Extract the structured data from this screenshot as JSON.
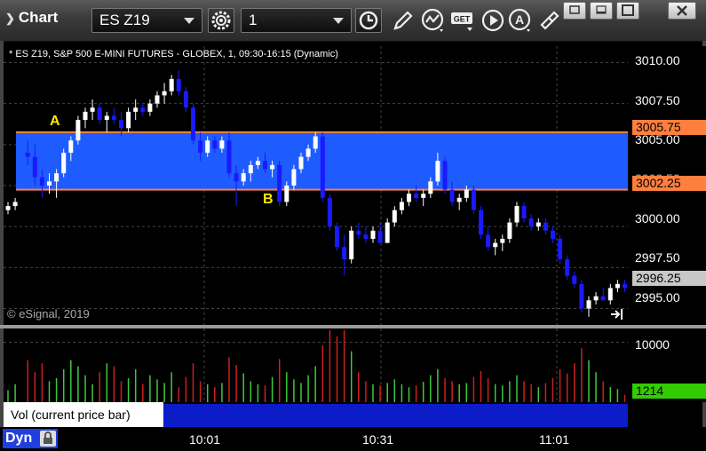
{
  "window": {
    "title": "Chart",
    "symbol": "ES Z19",
    "interval": "1"
  },
  "toolbar_icons": [
    "gear-icon",
    "clock-icon",
    "pencil-icon",
    "indicator-icon",
    "get-icon",
    "play-icon",
    "text-annotation-icon",
    "link-icon",
    "restore-icon",
    "minimize-icon",
    "maximize-icon",
    "close-icon"
  ],
  "chart_caption": "* ES Z19, S&P 500 E-MINI FUTURES - GLOBEX, 1, 09:30-16:15 (Dynamic)",
  "copyright": "© eSignal, 2019",
  "price_axis": {
    "labels": [
      "3010.00",
      "3007.50",
      "3005.00",
      "3002.50",
      "3000.00",
      "2997.50",
      "2995.00"
    ],
    "upper_line": "3005.75",
    "lower_line": "3002.25",
    "last_price": "2996.25"
  },
  "annotations": {
    "a": "A",
    "b": "B"
  },
  "volume": {
    "axis_label": "10000",
    "current": "1214",
    "legend": "Vol (current price bar)",
    "close_glyph": "×"
  },
  "time_axis": {
    "labels": [
      "10:01",
      "10:31",
      "11:01"
    ]
  },
  "dyn_label": "Dyn",
  "colors": {
    "up": "#ffffff",
    "down": "#1a1aff",
    "zone": "#1f5cff",
    "zone_line": "#ff7f3f",
    "vol_up": "#3cc83c",
    "vol_down": "#cc2020",
    "last_price_tag": "#c8c8c8",
    "vol_tag": "#33cc00"
  },
  "chart_data": {
    "type": "candlestick",
    "y_range": [
      2994.0,
      3011.0
    ],
    "zone": [
      3002.25,
      3005.75
    ],
    "last_price": 2996.25,
    "bars": [
      [
        3001.0,
        3001.5,
        3000.75,
        3001.25
      ],
      [
        3001.25,
        3001.75,
        3001.0,
        3001.5
      ],
      [
        3004.5,
        3005.25,
        3003.75,
        3004.25
      ],
      [
        3004.25,
        3005.0,
        3002.5,
        3003.0
      ],
      [
        3003.0,
        3003.5,
        3001.75,
        3002.5
      ],
      [
        3002.5,
        3003.25,
        3002.0,
        3002.75
      ],
      [
        3002.75,
        3003.5,
        3001.75,
        3003.25
      ],
      [
        3003.25,
        3004.75,
        3003.0,
        3004.5
      ],
      [
        3004.5,
        3005.5,
        3004.0,
        3005.25
      ],
      [
        3005.25,
        3006.75,
        3005.0,
        3006.5
      ],
      [
        3006.5,
        3007.25,
        3006.0,
        3007.0
      ],
      [
        3007.0,
        3007.75,
        3006.5,
        3007.25
      ],
      [
        3007.25,
        3007.5,
        3006.25,
        3006.5
      ],
      [
        3006.5,
        3007.0,
        3005.75,
        3006.75
      ],
      [
        3006.75,
        3007.25,
        3006.25,
        3006.5
      ],
      [
        3006.5,
        3007.0,
        3005.5,
        3006.0
      ],
      [
        3006.0,
        3007.25,
        3005.75,
        3007.0
      ],
      [
        3007.0,
        3007.75,
        3006.5,
        3007.25
      ],
      [
        3007.25,
        3007.5,
        3006.75,
        3007.0
      ],
      [
        3007.0,
        3007.75,
        3006.75,
        3007.5
      ],
      [
        3007.5,
        3008.25,
        3007.25,
        3008.0
      ],
      [
        3008.0,
        3008.75,
        3007.5,
        3008.25
      ],
      [
        3008.25,
        3009.25,
        3008.0,
        3009.0
      ],
      [
        3009.0,
        3009.5,
        3008.0,
        3008.25
      ],
      [
        3008.25,
        3008.5,
        3007.0,
        3007.25
      ],
      [
        3007.25,
        3007.5,
        3005.0,
        3005.25
      ],
      [
        3005.25,
        3005.75,
        3004.0,
        3004.5
      ],
      [
        3004.5,
        3005.5,
        3004.25,
        3005.25
      ],
      [
        3005.25,
        3005.5,
        3004.5,
        3004.75
      ],
      [
        3004.75,
        3005.5,
        3004.5,
        3005.25
      ],
      [
        3005.25,
        3005.75,
        3003.0,
        3003.25
      ],
      [
        3003.25,
        3003.75,
        3001.25,
        3002.75
      ],
      [
        3002.75,
        3003.5,
        3002.5,
        3003.25
      ],
      [
        3003.25,
        3004.0,
        3002.75,
        3003.75
      ],
      [
        3003.75,
        3004.25,
        3003.5,
        3004.0
      ],
      [
        3004.0,
        3004.5,
        3003.25,
        3003.5
      ],
      [
        3003.5,
        3004.0,
        3003.0,
        3003.75
      ],
      [
        3003.75,
        3004.0,
        3001.25,
        3001.5
      ],
      [
        3001.5,
        3002.75,
        3001.25,
        3002.5
      ],
      [
        3002.5,
        3003.75,
        3002.25,
        3003.5
      ],
      [
        3003.5,
        3004.5,
        3003.25,
        3004.25
      ],
      [
        3004.25,
        3005.0,
        3004.0,
        3004.75
      ],
      [
        3004.75,
        3005.75,
        3004.5,
        3005.5
      ],
      [
        3005.5,
        3005.75,
        3001.5,
        3001.75
      ],
      [
        3001.75,
        3002.0,
        2999.75,
        3000.0
      ],
      [
        3000.0,
        3000.25,
        2998.5,
        2998.75
      ],
      [
        2998.75,
        2999.5,
        2997.0,
        2998.0
      ],
      [
        2998.0,
        3000.0,
        2997.75,
        2999.75
      ],
      [
        2999.75,
        3000.25,
        2999.25,
        2999.5
      ],
      [
        2999.5,
        3000.0,
        2999.0,
        2999.25
      ],
      [
        2999.25,
        3000.0,
        2999.0,
        2999.75
      ],
      [
        2999.75,
        3000.25,
        2999.25,
        2999.0
      ],
      [
        2999.0,
        3000.5,
        2999.0,
        3000.25
      ],
      [
        3000.25,
        3001.25,
        3000.0,
        3001.0
      ],
      [
        3001.0,
        3001.75,
        3000.75,
        3001.5
      ],
      [
        3001.5,
        3002.25,
        3001.25,
        3002.0
      ],
      [
        3002.0,
        3002.5,
        3001.5,
        3001.75
      ],
      [
        3001.75,
        3002.25,
        3001.25,
        3002.0
      ],
      [
        3002.0,
        3003.0,
        3001.75,
        3002.75
      ],
      [
        3002.75,
        3004.5,
        3002.5,
        3004.0
      ],
      [
        3004.0,
        3004.25,
        3002.0,
        3002.25
      ],
      [
        3002.25,
        3002.75,
        3001.25,
        3001.5
      ],
      [
        3001.5,
        3002.0,
        3001.0,
        3001.75
      ],
      [
        3001.75,
        3002.5,
        3001.5,
        3002.25
      ],
      [
        3002.25,
        3002.5,
        3000.75,
        3001.0
      ],
      [
        3001.0,
        3001.25,
        2999.25,
        2999.5
      ],
      [
        2999.5,
        3000.0,
        2998.5,
        2998.75
      ],
      [
        2998.75,
        2999.25,
        2998.25,
        2999.0
      ],
      [
        2999.0,
        2999.5,
        2998.5,
        2999.25
      ],
      [
        2999.25,
        3000.5,
        2999.0,
        3000.25
      ],
      [
        3000.25,
        3001.5,
        3000.0,
        3001.25
      ],
      [
        3001.25,
        3001.5,
        3000.25,
        3000.5
      ],
      [
        3000.5,
        3000.75,
        2999.75,
        3000.0
      ],
      [
        3000.0,
        3000.5,
        2999.75,
        3000.25
      ],
      [
        3000.25,
        3000.5,
        2999.5,
        2999.75
      ],
      [
        2999.75,
        3000.0,
        2999.0,
        2999.25
      ],
      [
        2999.25,
        2999.5,
        2997.75,
        2998.0
      ],
      [
        2998.0,
        2998.25,
        2996.75,
        2997.0
      ],
      [
        2997.0,
        2997.25,
        2996.25,
        2996.5
      ],
      [
        2996.5,
        2996.75,
        2994.75,
        2995.0
      ],
      [
        2995.0,
        2995.75,
        2994.5,
        2995.5
      ],
      [
        2995.5,
        2996.0,
        2995.25,
        2995.75
      ],
      [
        2995.75,
        2996.25,
        2995.5,
        2995.5
      ],
      [
        2995.5,
        2996.5,
        2995.25,
        2996.25
      ],
      [
        2996.25,
        2996.75,
        2996.0,
        2996.5
      ],
      [
        2996.5,
        2996.75,
        2996.0,
        2996.25
      ]
    ],
    "volume_max": 12000,
    "volume": [
      2000,
      3000,
      7000,
      5000,
      6500,
      3500,
      4000,
      5500,
      7000,
      6000,
      4500,
      3000,
      5000,
      6500,
      6000,
      3500,
      4000,
      5500,
      3000,
      4500,
      3800,
      3200,
      5000,
      2500,
      4200,
      6500,
      3500,
      3000,
      2500,
      3200,
      7500,
      6200,
      4800,
      3500,
      3000,
      2800,
      4200,
      7200,
      5000,
      3800,
      3200,
      4500,
      6000,
      9500,
      12000,
      11000,
      12000,
      8500,
      5000,
      3500,
      3000,
      2800,
      3200,
      3800,
      3000,
      2500,
      2800,
      3400,
      4500,
      5500,
      4000,
      3500,
      3000,
      3200,
      4200,
      5200,
      4000,
      3000,
      2800,
      3500,
      4500,
      3500,
      3000,
      2500,
      3200,
      4000,
      5500,
      4800,
      6500,
      9000,
      7000,
      5000,
      3500,
      2500,
      2200,
      1214
    ]
  }
}
